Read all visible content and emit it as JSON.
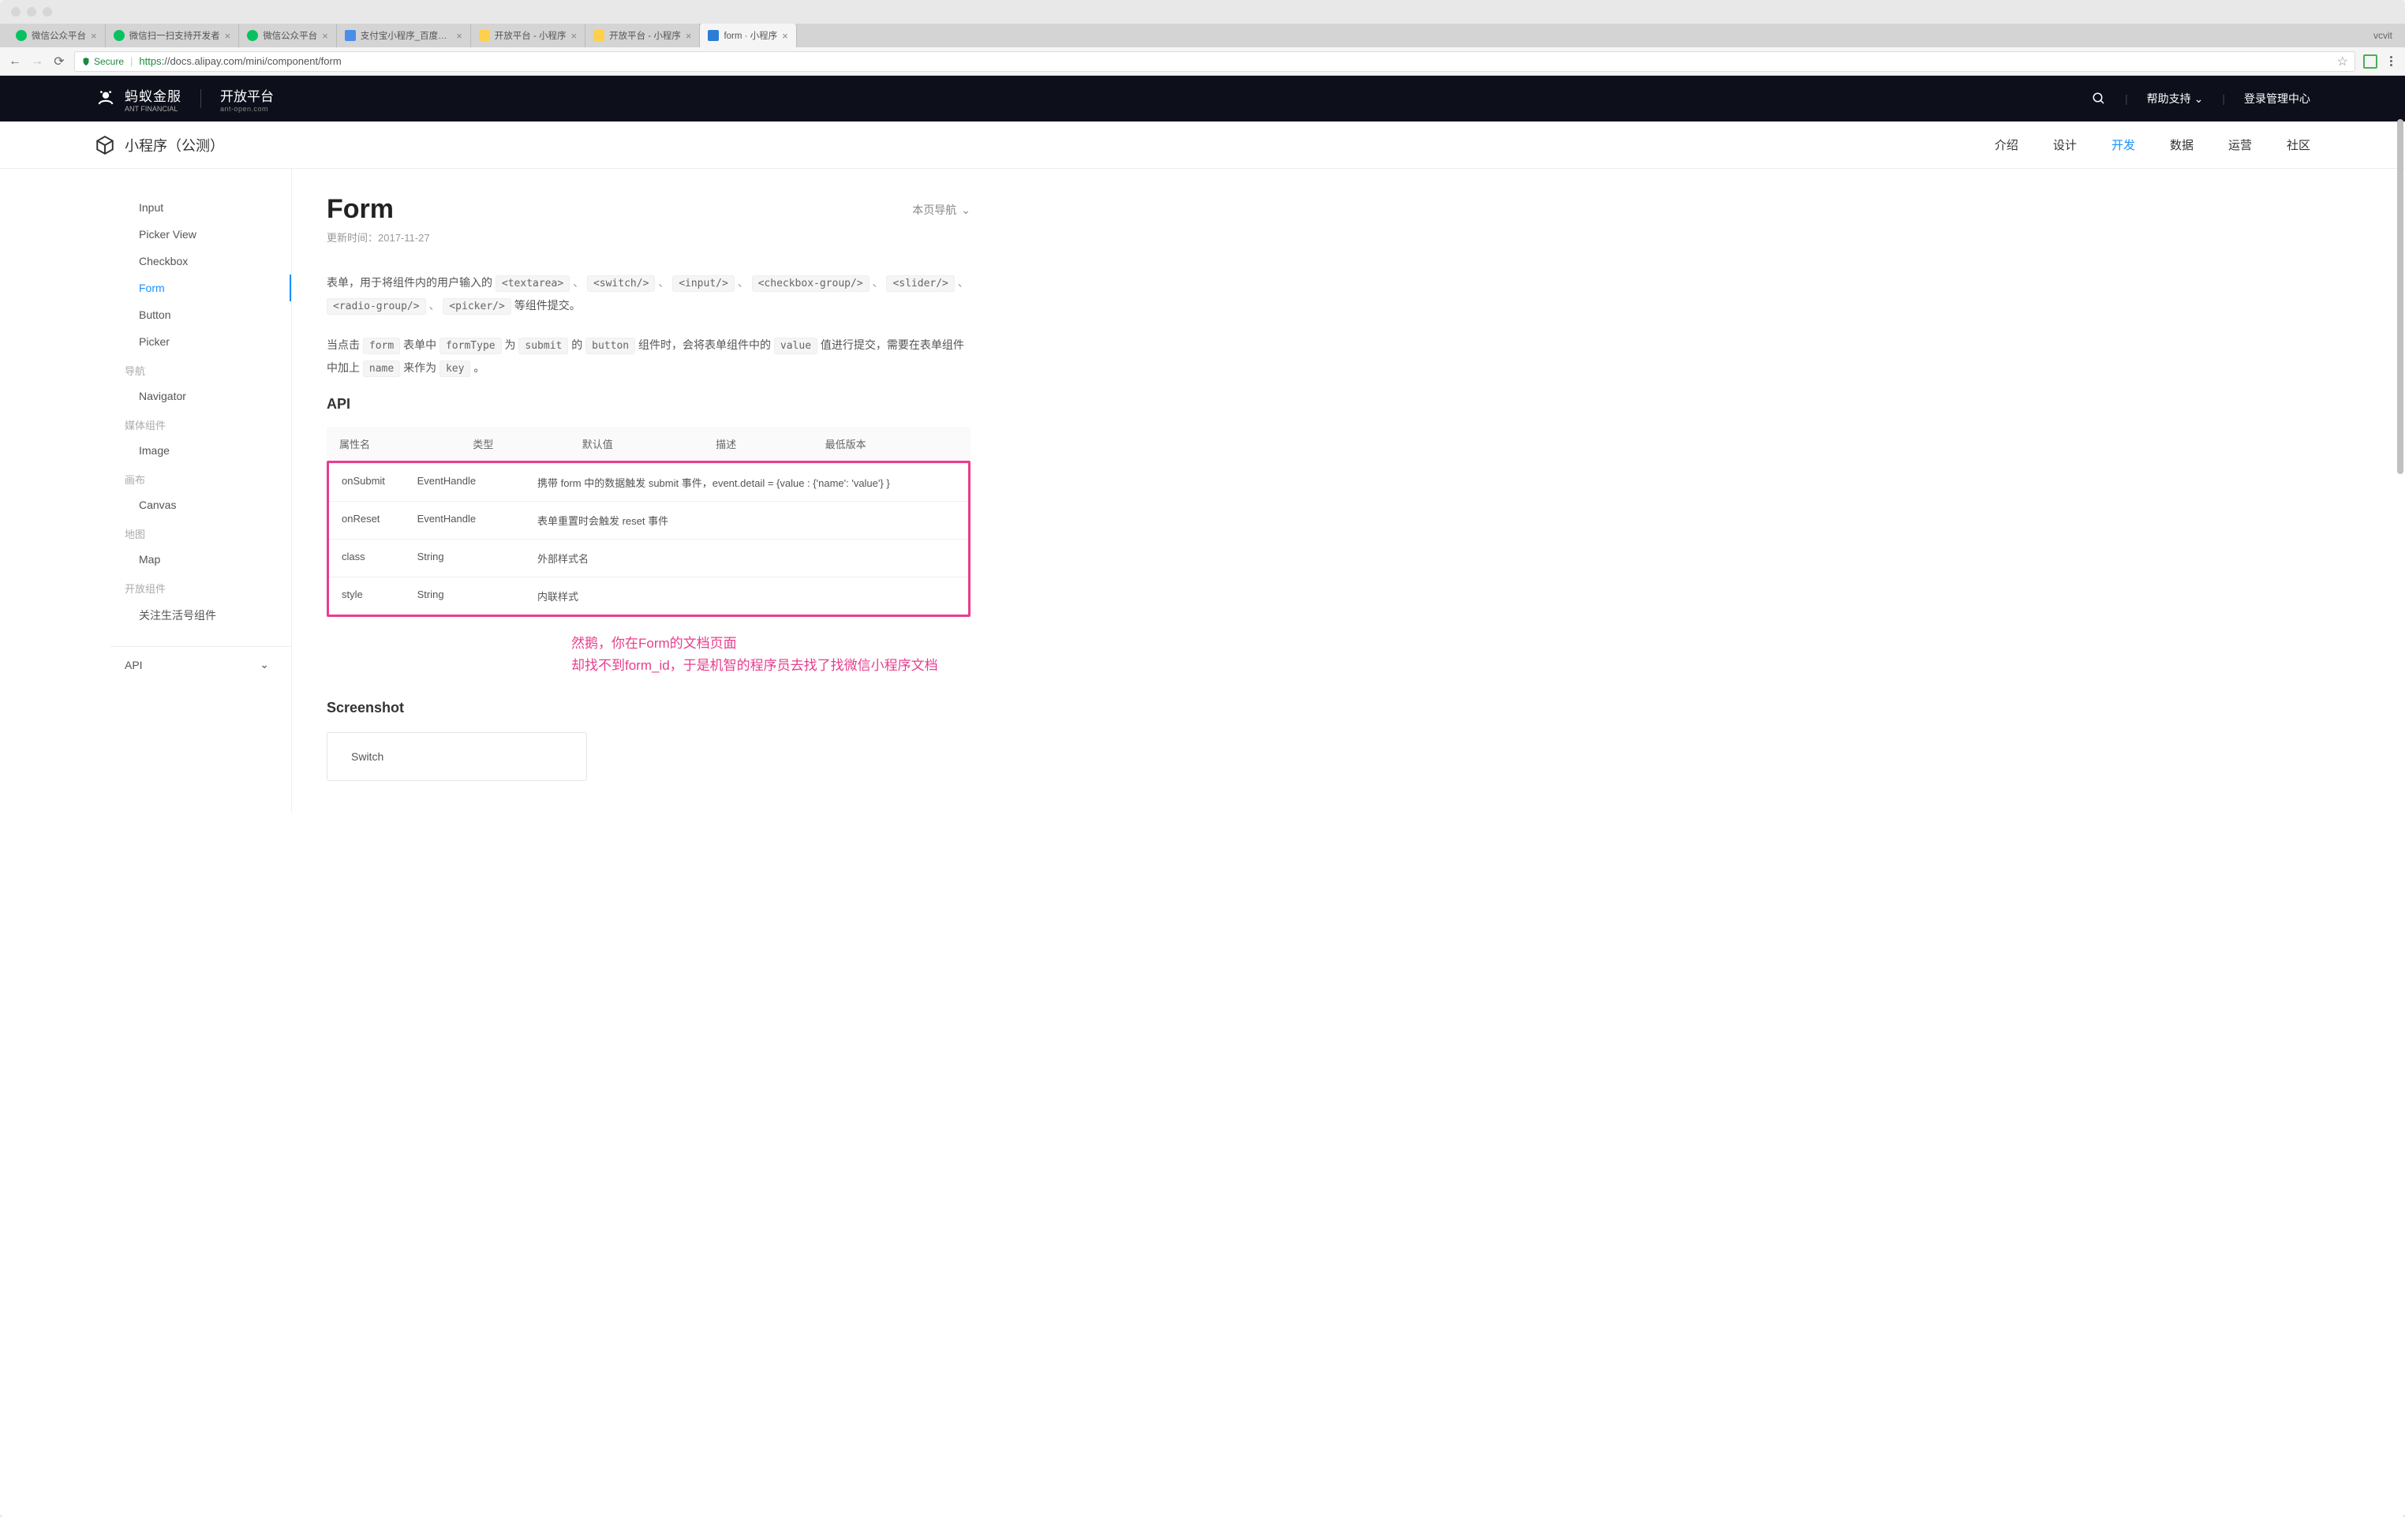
{
  "browser": {
    "user": "vcvit",
    "tabs": [
      {
        "title": "微信公众平台",
        "fav": "fav-green"
      },
      {
        "title": "微信扫一扫支持开发者",
        "fav": "fav-green"
      },
      {
        "title": "微信公众平台",
        "fav": "fav-green"
      },
      {
        "title": "支付宝小程序_百度搜索",
        "fav": "fav-blue"
      },
      {
        "title": "开放平台 - 小程序",
        "fav": "fav-yellow"
      },
      {
        "title": "开放平台 - 小程序",
        "fav": "fav-yellow"
      },
      {
        "title": "form · 小程序",
        "fav": "fav-navy"
      }
    ],
    "active_tab": 6,
    "secure_label": "Secure",
    "url_proto": "https",
    "url_host_path": "://docs.alipay.com/mini/component/form"
  },
  "topnav": {
    "brand_main": "蚂蚁金服",
    "brand_main_sub": "ANT FINANCIAL",
    "brand_open": "开放平台",
    "brand_open_sub": "ant-open.com",
    "help": "帮助支持",
    "login": "登录管理中心"
  },
  "subnav": {
    "title": "小程序（公测）",
    "items": [
      "介绍",
      "设计",
      "开发",
      "数据",
      "运营",
      "社区"
    ],
    "active_index": 2
  },
  "sidebar": {
    "items": [
      {
        "type": "leaf",
        "label": "Input"
      },
      {
        "type": "leaf",
        "label": "Picker View"
      },
      {
        "type": "leaf",
        "label": "Checkbox"
      },
      {
        "type": "leaf",
        "label": "Form",
        "active": true
      },
      {
        "type": "leaf",
        "label": "Button"
      },
      {
        "type": "leaf",
        "label": "Picker"
      },
      {
        "type": "group",
        "label": "导航"
      },
      {
        "type": "leaf",
        "label": "Navigator"
      },
      {
        "type": "group",
        "label": "媒体组件"
      },
      {
        "type": "leaf",
        "label": "Image"
      },
      {
        "type": "group",
        "label": "画布"
      },
      {
        "type": "leaf",
        "label": "Canvas"
      },
      {
        "type": "group",
        "label": "地图"
      },
      {
        "type": "leaf",
        "label": "Map"
      },
      {
        "type": "group",
        "label": "开放组件"
      },
      {
        "type": "leaf",
        "label": "关注生活号组件"
      }
    ],
    "api_label": "API"
  },
  "content": {
    "title": "Form",
    "page_nav_label": "本页导航",
    "update_label": "更新时间：",
    "update_value": "2017-11-27",
    "desc1_pre": "表单，用于将组件内的用户输入的 ",
    "desc1_chips": [
      "<textarea>",
      "<switch/>",
      "<input/>",
      "<checkbox-group/>",
      "<slider/>",
      "<radio-group/>",
      "<picker/>"
    ],
    "desc1_suffix": " 等组件提交。",
    "desc2_parts": {
      "t1": "当点击 ",
      "c1": "form",
      "t2": " 表单中 ",
      "c2": "formType",
      "t3": " 为 ",
      "c3": "submit",
      "t4": " 的 ",
      "c4": "button",
      "t5": " 组件时，会将表单组件中的 ",
      "c5": "value",
      "t6": " 值进行提交，需要在表单组件中加上 ",
      "c6": "name",
      "t7": " 来作为 ",
      "c7": "key",
      "t8": " 。"
    },
    "api_heading": "API",
    "table_headers": [
      "属性名",
      "类型",
      "默认值",
      "描述",
      "最低版本"
    ],
    "table_rows": [
      {
        "attr": "onSubmit",
        "type": "EventHandle",
        "default": "",
        "desc": "携带 form 中的数据触发 submit 事件，event.detail = {value : {'name': 'value'} }",
        "min": ""
      },
      {
        "attr": "onReset",
        "type": "EventHandle",
        "default": "",
        "desc": "表单重置时会触发 reset 事件",
        "min": ""
      },
      {
        "attr": "class",
        "type": "String",
        "default": "",
        "desc": "外部样式名",
        "min": ""
      },
      {
        "attr": "style",
        "type": "String",
        "default": "",
        "desc": "内联样式",
        "min": ""
      }
    ],
    "annotation_l1": "然鹅，你在Form的文档页面",
    "annotation_l2": "却找不到form_id，于是机智的程序员去找了找微信小程序文档",
    "screenshot_heading": "Screenshot",
    "screenshot_switch": "Switch"
  }
}
